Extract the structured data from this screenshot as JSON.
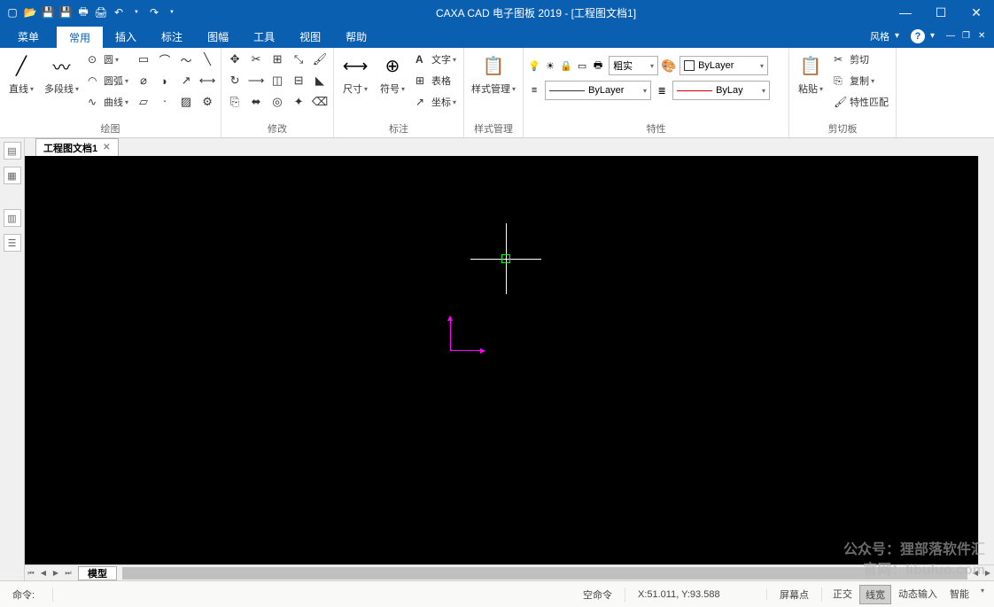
{
  "title": "CAXA CAD 电子图板 2019 - [工程图文档1]",
  "qat": [
    "new",
    "open",
    "save",
    "saveall",
    "plot",
    "print",
    "undo",
    "redo"
  ],
  "menu": {
    "file": "菜单",
    "tabs": [
      "常用",
      "插入",
      "标注",
      "图幅",
      "工具",
      "视图",
      "帮助"
    ],
    "active": 0,
    "style": "风格"
  },
  "ribbon": {
    "draw": {
      "title": "绘图",
      "line": "直线",
      "pline": "多段线",
      "circle": "圆",
      "arc": "圆弧",
      "curve": "曲线"
    },
    "modify": {
      "title": "修改"
    },
    "dim": {
      "title": "标注",
      "size": "尺寸",
      "symbol": "符号",
      "a": "A",
      "text": "文字",
      "table": "表格",
      "coord": "坐标"
    },
    "style": {
      "title": "样式管理",
      "label": "样式管理"
    },
    "props": {
      "title": "特性",
      "linetype": "粗实",
      "layer": "ByLayer",
      "lt2": "ByLayer",
      "lw": "ByLay"
    },
    "clip": {
      "title": "剪切板",
      "paste": "粘贴",
      "cut": "剪切",
      "copy": "复制",
      "match": "特性匹配"
    }
  },
  "doc": {
    "tab": "工程图文档1",
    "model": "模型"
  },
  "status": {
    "cmd_label": "命令:",
    "empty_cmd": "空命令",
    "coords": "X:51.011, Y:93.588",
    "screen": "屏幕点",
    "ortho": "正交",
    "lwt": "线宽",
    "dyn": "动态输入",
    "snap": "智能"
  },
  "watermark": {
    "l1": "公众号：狸部落软件汇",
    "l2": "官网：libuluo.com"
  }
}
